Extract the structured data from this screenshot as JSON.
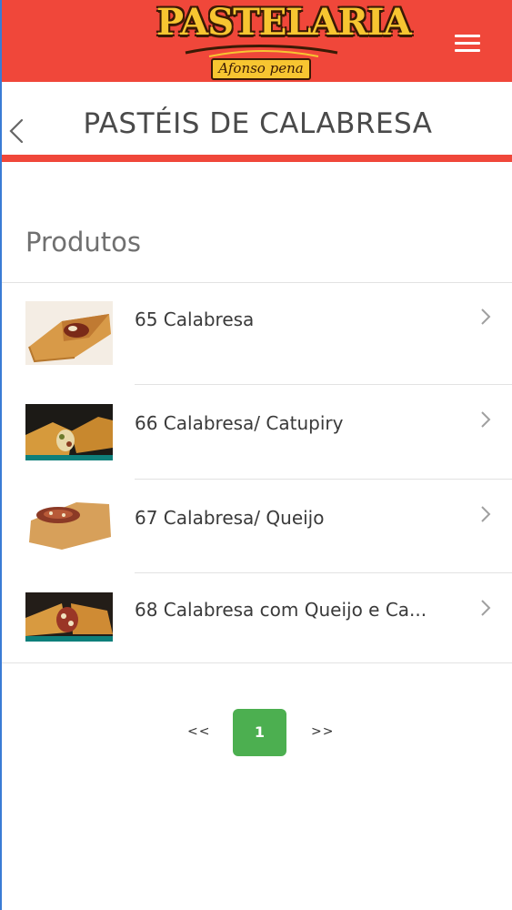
{
  "header": {
    "logo_main": "PASTELARIA",
    "logo_sub": "Afonso pena",
    "menu_icon": "hamburger-menu-icon",
    "brand_color": "#f0473a"
  },
  "title_bar": {
    "back_icon": "chevron-left-icon",
    "title": "PASTÉIS DE CALABRESA"
  },
  "section": {
    "heading": "Produtos"
  },
  "products": [
    {
      "label": "65 Calabresa",
      "thumb_icon": "pastel-photo"
    },
    {
      "label": "66 Calabresa/ Catupiry",
      "thumb_icon": "pastel-photo"
    },
    {
      "label": "67 Calabresa/ Queijo",
      "thumb_icon": "pastel-photo"
    },
    {
      "label": "68 Calabresa com Queijo e Ca...",
      "thumb_icon": "pastel-photo"
    }
  ],
  "pagination": {
    "prev": "<<",
    "current": "1",
    "next": ">>",
    "active_color": "#4caf50"
  }
}
